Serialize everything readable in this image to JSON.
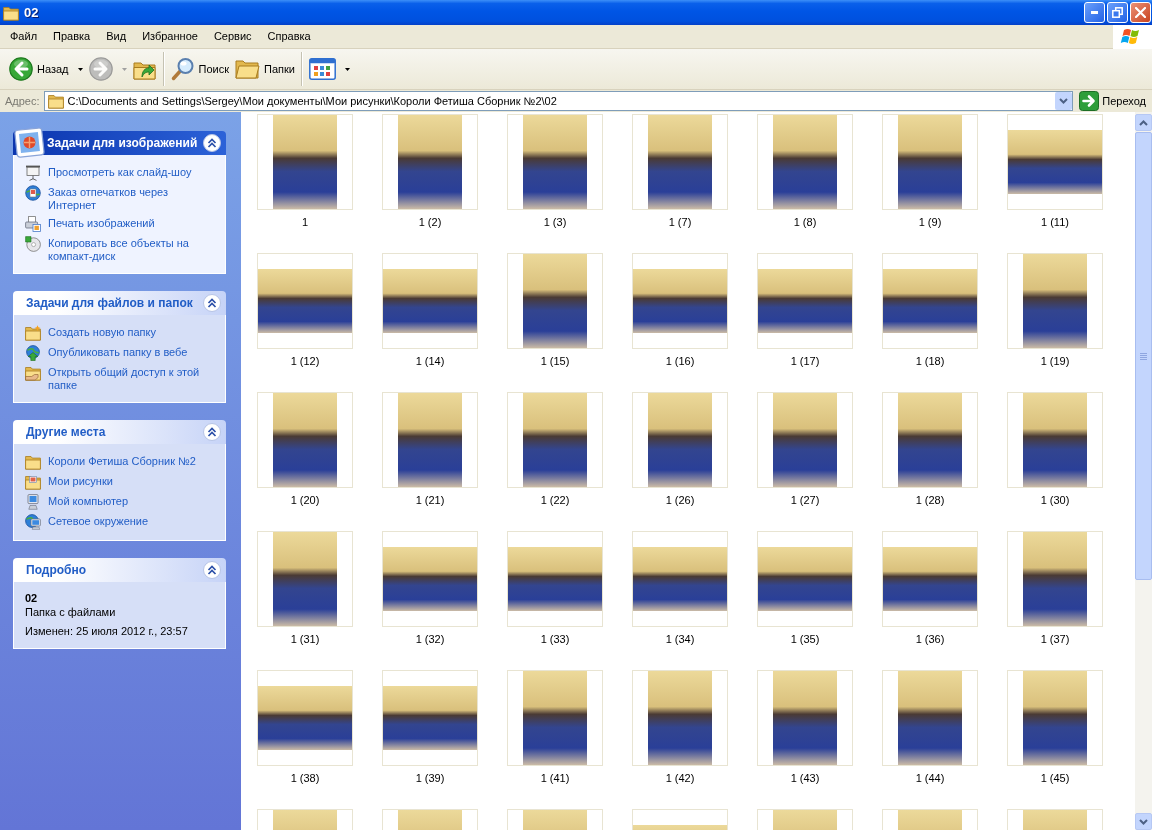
{
  "window": {
    "title": "02"
  },
  "menu": [
    "Файл",
    "Правка",
    "Вид",
    "Избранное",
    "Сервис",
    "Справка"
  ],
  "toolbar": [
    {
      "kind": "back",
      "label": "Назад",
      "dropdown": true,
      "disabled": false
    },
    {
      "kind": "forward",
      "dropdown": true,
      "disabled": true
    },
    {
      "kind": "up",
      "dropdown": false,
      "disabled": false
    },
    {
      "kind": "separator"
    },
    {
      "kind": "search",
      "label": "Поиск",
      "dropdown": false,
      "disabled": false
    },
    {
      "kind": "folders",
      "label": "Папки",
      "dropdown": false,
      "disabled": false
    },
    {
      "kind": "separator"
    },
    {
      "kind": "views",
      "dropdown": true,
      "disabled": false
    }
  ],
  "address_bar": {
    "label": "Адрес:",
    "path": "C:\\Documents and Settings\\Sergey\\Мои документы\\Мои рисунки\\Короли Фетиша Сборник №2\\02",
    "go_label": "Переход"
  },
  "task_panes": [
    {
      "kind": "special",
      "title": "Задачи для изображений",
      "expanded": true,
      "items": [
        {
          "kind": "slideshow",
          "label": "Просмотреть как слайд-шоу"
        },
        {
          "kind": "order-prints",
          "label": "Заказ отпечатков через Интернет"
        },
        {
          "kind": "print",
          "label": "Печать изображений"
        },
        {
          "kind": "copy-to-cd",
          "label": "Копировать все объекты на компакт-диск"
        }
      ]
    },
    {
      "kind": "tasks",
      "title": "Задачи для файлов и папок",
      "expanded": true,
      "items": [
        {
          "kind": "new-folder",
          "label": "Создать новую папку"
        },
        {
          "kind": "publish",
          "label": "Опубликовать папку в вебе"
        },
        {
          "kind": "share",
          "label": "Открыть общий доступ к этой папке"
        }
      ]
    },
    {
      "kind": "tasks",
      "title": "Другие места",
      "expanded": true,
      "items": [
        {
          "kind": "folder",
          "label": "Короли Фетиша Сборник №2"
        },
        {
          "kind": "pictures",
          "label": "Мои рисунки"
        },
        {
          "kind": "computer",
          "label": "Мой компьютер"
        },
        {
          "kind": "network",
          "label": "Сетевое окружение"
        }
      ]
    },
    {
      "kind": "details",
      "title": "Подробно",
      "expanded": true,
      "name": "02",
      "type": "Папка с файлами",
      "modified": "Изменен: 25 июля 2012 г., 23:57"
    }
  ],
  "thumbnails": [
    {
      "label": "1",
      "kind": "portrait",
      "selected": false
    },
    {
      "label": "1 (2)",
      "kind": "portrait",
      "selected": false
    },
    {
      "label": "1 (3)",
      "kind": "portrait",
      "selected": false
    },
    {
      "label": "1 (7)",
      "kind": "portrait",
      "selected": false
    },
    {
      "label": "1 (8)",
      "kind": "portrait",
      "selected": false
    },
    {
      "label": "1 (9)",
      "kind": "portrait",
      "selected": false
    },
    {
      "label": "1 (11)",
      "kind": "landscape",
      "selected": false
    },
    {
      "label": "1 (12)",
      "kind": "landscape",
      "selected": false
    },
    {
      "label": "1 (14)",
      "kind": "landscape",
      "selected": false
    },
    {
      "label": "1 (15)",
      "kind": "portrait",
      "selected": false
    },
    {
      "label": "1 (16)",
      "kind": "landscape",
      "selected": false
    },
    {
      "label": "1 (17)",
      "kind": "landscape",
      "selected": false
    },
    {
      "label": "1 (18)",
      "kind": "landscape",
      "selected": false
    },
    {
      "label": "1 (19)",
      "kind": "portrait",
      "selected": false
    },
    {
      "label": "1 (20)",
      "kind": "portrait",
      "selected": false
    },
    {
      "label": "1 (21)",
      "kind": "portrait",
      "selected": false
    },
    {
      "label": "1 (22)",
      "kind": "portrait",
      "selected": false
    },
    {
      "label": "1 (26)",
      "kind": "portrait",
      "selected": false
    },
    {
      "label": "1 (27)",
      "kind": "portrait",
      "selected": false
    },
    {
      "label": "1 (28)",
      "kind": "portrait",
      "selected": false
    },
    {
      "label": "1 (30)",
      "kind": "portrait",
      "selected": false
    },
    {
      "label": "1 (31)",
      "kind": "portrait",
      "selected": false
    },
    {
      "label": "1 (32)",
      "kind": "landscape",
      "selected": false
    },
    {
      "label": "1 (33)",
      "kind": "landscape",
      "selected": false
    },
    {
      "label": "1 (34)",
      "kind": "landscape",
      "selected": false
    },
    {
      "label": "1 (35)",
      "kind": "landscape",
      "selected": false
    },
    {
      "label": "1 (36)",
      "kind": "landscape",
      "selected": false
    },
    {
      "label": "1 (37)",
      "kind": "portrait",
      "selected": false
    },
    {
      "label": "1 (38)",
      "kind": "landscape",
      "selected": false
    },
    {
      "label": "1 (39)",
      "kind": "landscape",
      "selected": false
    },
    {
      "label": "1 (41)",
      "kind": "portrait",
      "selected": false
    },
    {
      "label": "1 (42)",
      "kind": "portrait",
      "selected": false
    },
    {
      "label": "1 (43)",
      "kind": "portrait",
      "selected": false
    },
    {
      "label": "1 (44)",
      "kind": "portrait",
      "selected": false
    },
    {
      "label": "1 (45)",
      "kind": "portrait",
      "selected": false
    },
    {
      "kind": "portrait",
      "selected": false
    },
    {
      "kind": "portrait",
      "selected": false
    },
    {
      "kind": "portrait",
      "selected": false
    },
    {
      "kind": "landscape",
      "selected": false
    },
    {
      "kind": "portrait",
      "selected": false
    },
    {
      "kind": "portrait",
      "selected": false
    },
    {
      "kind": "portrait",
      "selected": false
    }
  ]
}
